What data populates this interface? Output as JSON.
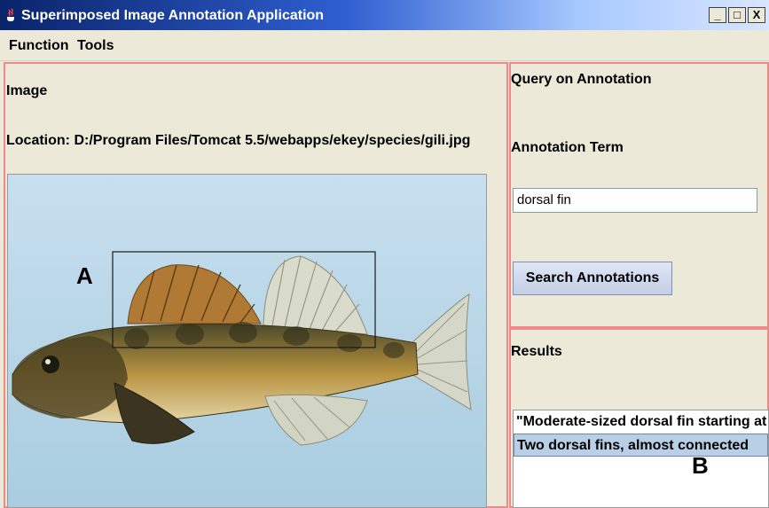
{
  "window": {
    "title": "Superimposed Image Annotation Application",
    "app_icon": "java-cup-icon",
    "controls": [
      "_",
      "□",
      "X"
    ]
  },
  "menu": {
    "items": [
      {
        "label": "Function"
      },
      {
        "label": "Tools"
      }
    ]
  },
  "image_panel": {
    "heading": "Image",
    "location": "Location: D:/Program Files/Tomcat 5.5/webapps/ekey/species/gili.jpg",
    "marker_a": "A"
  },
  "query_panel": {
    "heading": "Query on Annotation",
    "term_label": "Annotation Term",
    "term_value": "dorsal fin",
    "search_button": "Search Annotations"
  },
  "results_panel": {
    "heading": "Results",
    "items": [
      {
        "text": "\"Moderate-sized dorsal fin starting at the"
      },
      {
        "text": "Two dorsal fins, almost connected"
      }
    ],
    "selected_index": 1,
    "marker_b": "B"
  },
  "colors": {
    "panel_border": "#f08a8a",
    "selection": "#b8cfe5",
    "title_gradient_start": "#0a246a"
  }
}
